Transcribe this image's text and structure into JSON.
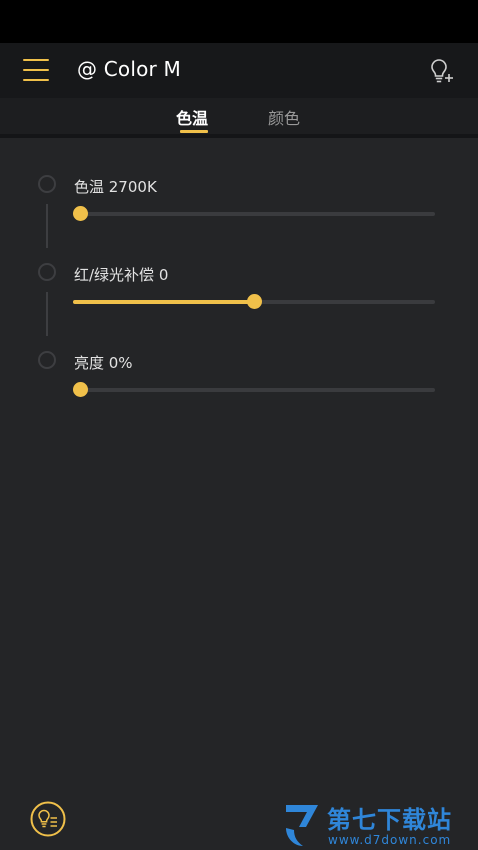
{
  "header": {
    "title": "@ Color M"
  },
  "tabs": [
    {
      "label": "色温",
      "active": true
    },
    {
      "label": "颜色",
      "active": false
    }
  ],
  "controls": [
    {
      "label": "色温 2700K",
      "value": 0
    },
    {
      "label": "红/绿光补偿 0",
      "value": 0.5
    },
    {
      "label": "亮度 0%",
      "value": 0
    }
  ],
  "watermark": {
    "name": "第七下载站",
    "url": "www.d7down.com"
  },
  "colors": {
    "accent": "#f0c04a",
    "background": "#242527",
    "appbar": "#17181a",
    "watermark": "#2f86d9"
  },
  "icons": {
    "menu": "hamburger-menu-icon",
    "add_light": "bulb-plus-icon",
    "light_list": "bulb-list-icon"
  }
}
